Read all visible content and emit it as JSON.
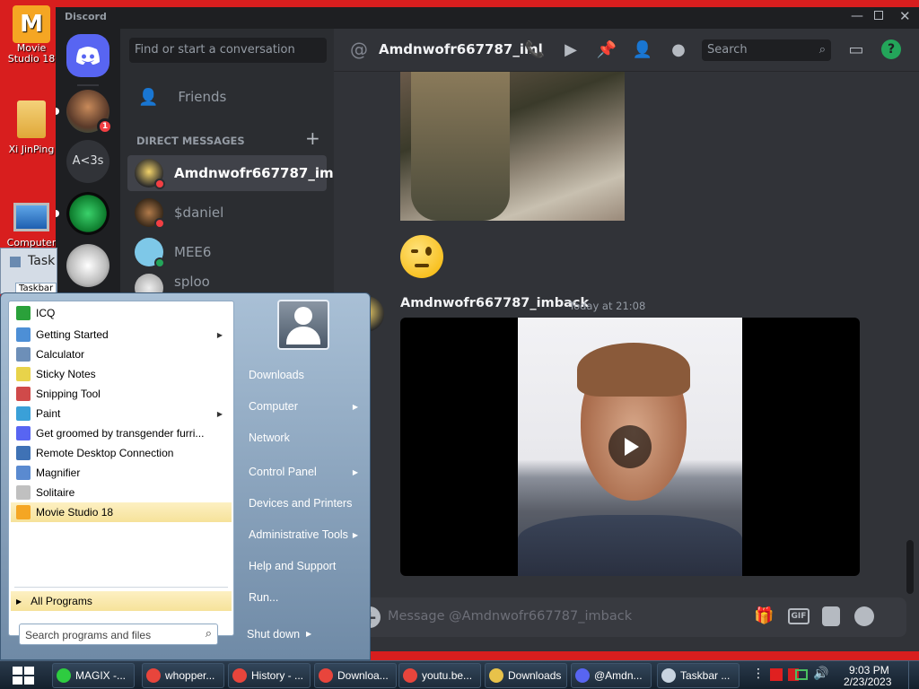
{
  "desktop": {
    "icons": [
      {
        "label": "Movie Studio 18"
      },
      {
        "label": "Xi JinPing"
      },
      {
        "label": "Computer"
      }
    ]
  },
  "discord": {
    "app_title": "Discord",
    "search_convo_placeholder": "Find or start a conversation",
    "friends_label": "Friends",
    "direct_messages_header": "DIRECT MESSAGES",
    "add_dm": "+",
    "server_badge": "1",
    "server_text": "A<3s",
    "dms": [
      {
        "name": "Amdnwofr667787_im...",
        "status": "dnd"
      },
      {
        "name": "$daniel",
        "status": "dnd"
      },
      {
        "name": "MEE6",
        "status": "online"
      },
      {
        "name": "sploo",
        "status": "none"
      }
    ],
    "channel_title": "Amdnwofr667787_iml",
    "search_placeholder": "Search",
    "message": {
      "author": "Amdnwofr667787_imback",
      "timestamp": "Today at 21:08"
    },
    "composer_placeholder": "Message @Amdnwofr667787_imback",
    "gif_label": "GIF"
  },
  "startmenu": {
    "left_items": [
      {
        "label": "ICQ",
        "color": "#2aa13a",
        "arrow": false
      },
      {
        "label": "Getting Started",
        "color": "#4d8fd6",
        "arrow": true
      },
      {
        "label": "Calculator",
        "color": "#6d8fb8",
        "arrow": false
      },
      {
        "label": "Sticky Notes",
        "color": "#e8d34a",
        "arrow": false
      },
      {
        "label": "Snipping Tool",
        "color": "#d04a4a",
        "arrow": false
      },
      {
        "label": "Paint",
        "color": "#3aa0d8",
        "arrow": true
      },
      {
        "label": "Get groomed by transgender furri...",
        "color": "#5865f2",
        "arrow": false
      },
      {
        "label": "Remote Desktop Connection",
        "color": "#3f72b5",
        "arrow": false
      },
      {
        "label": "Magnifier",
        "color": "#5a8ad0",
        "arrow": false
      },
      {
        "label": "Solitaire",
        "color": "#c0c0c0",
        "arrow": false
      },
      {
        "label": "Movie Studio 18",
        "color": "#f5a623",
        "arrow": false
      }
    ],
    "all_programs": "All Programs",
    "search_placeholder": "Search programs and files",
    "right_items": [
      {
        "label": "Downloads",
        "arrow": false
      },
      {
        "label": "Computer",
        "arrow": true
      },
      {
        "label": "Network",
        "arrow": false
      },
      {
        "label": "Control Panel",
        "arrow": true
      },
      {
        "label": "Devices and Printers",
        "arrow": false
      },
      {
        "label": "Administrative Tools",
        "arrow": true
      },
      {
        "label": "Help and Support",
        "arrow": false
      },
      {
        "label": "Run...",
        "arrow": false
      }
    ],
    "shutdown": "Shut down"
  },
  "behind_window": {
    "title": "Task",
    "tab": "Taskbar"
  },
  "taskbar": {
    "buttons": [
      {
        "label": "MAGIX -...",
        "color": "#2ecc40"
      },
      {
        "label": "whopper...",
        "color": "#e8453c"
      },
      {
        "label": "History - ...",
        "color": "#e8453c"
      },
      {
        "label": "Downloa...",
        "color": "#e8453c"
      },
      {
        "label": "youtu.be...",
        "color": "#e8453c"
      },
      {
        "label": "Downloads",
        "color": "#e8c24a"
      },
      {
        "label": "@Amdn...",
        "color": "#5865f2"
      },
      {
        "label": "Taskbar ...",
        "color": "#c8d4e0"
      }
    ],
    "time": "9:03 PM",
    "date": "2/23/2023"
  }
}
